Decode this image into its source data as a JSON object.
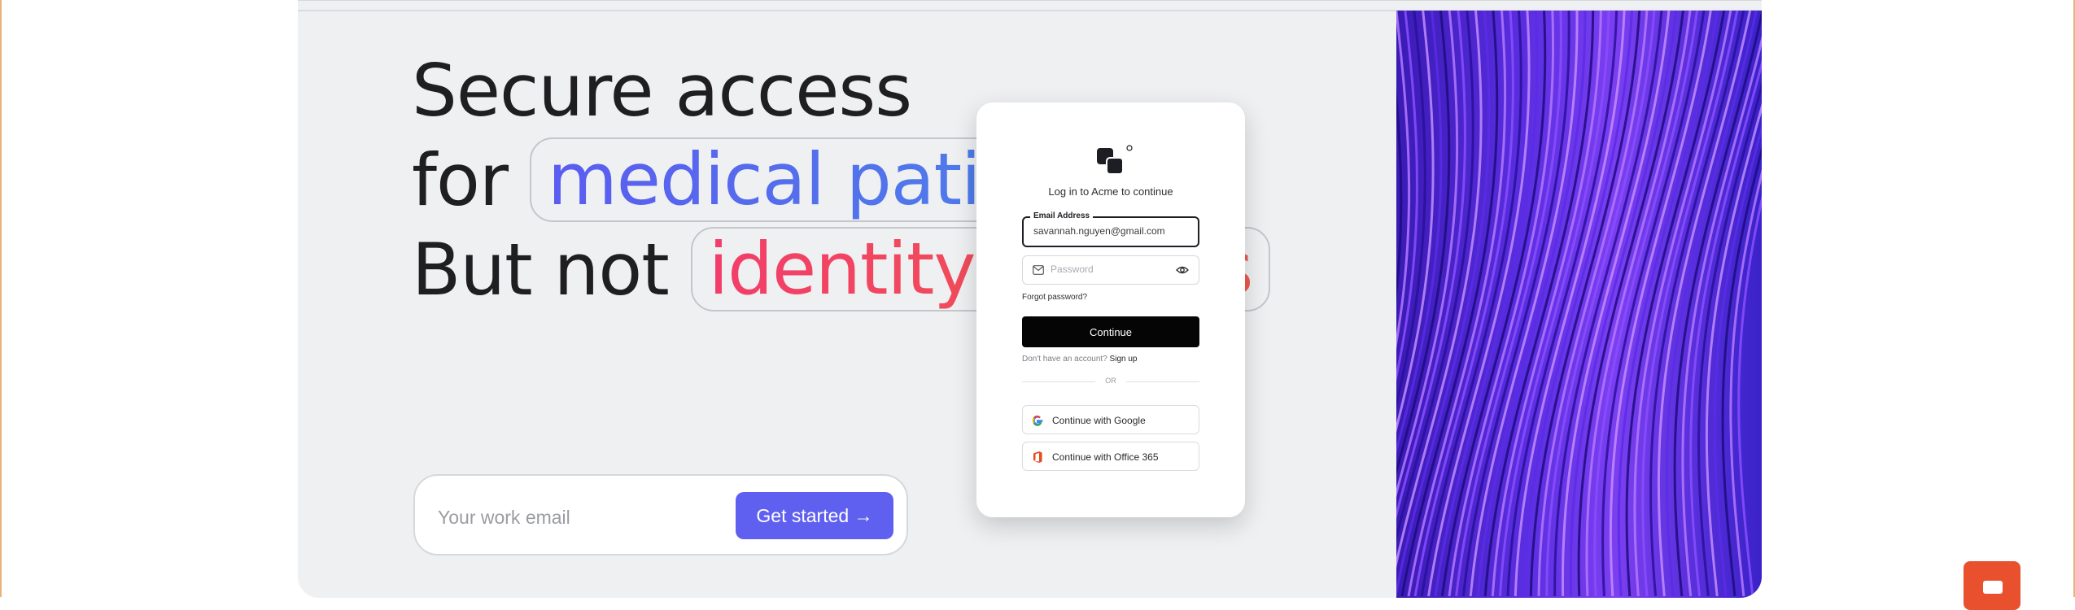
{
  "hero": {
    "headline": {
      "line1": "Secure access",
      "line2_prefix": "for",
      "line2_highlight": "medical patients",
      "line3_prefix": "But not",
      "line3_highlight": "identity thieves"
    },
    "email_placeholder": "Your work email",
    "cta_label": "Get started →"
  },
  "login": {
    "title": "Log in to Acme to continue",
    "email_label": "Email Address",
    "email_value": "savannah.nguyen@gmail.com",
    "password_placeholder": "Password",
    "forgot_label": "Forgot password?",
    "continue_label": "Continue",
    "no_account_text": "Don't have an account?",
    "signup_label": "Sign up",
    "or_label": "OR",
    "google_label": "Continue with Google",
    "office_label": "Continue with Office 365"
  },
  "icons": {
    "logo": "acme-logo-icon",
    "mail": "mail-icon",
    "eye": "eye-icon",
    "google": "google-icon",
    "office": "office-365-icon",
    "chat": "chat-icon"
  },
  "colors": {
    "cta": "#6060f0",
    "continue": "#050505",
    "highlight_blue_start": "#5b5cf0",
    "highlight_blue_end": "#4a86e8",
    "highlight_red_start": "#f23d6a",
    "highlight_red_end": "#f05a4a",
    "chat_widget": "#e8502e"
  }
}
